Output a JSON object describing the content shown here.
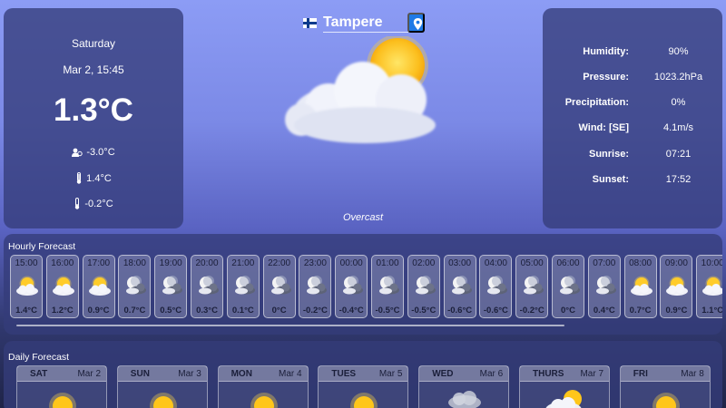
{
  "current": {
    "day": "Saturday",
    "datetime": "Mar 2, 15:45",
    "temperature": "1.3°C",
    "feels_like": "-3.0°C",
    "high": "1.4°C",
    "low": "-0.2°C",
    "condition": "Overcast",
    "icon": "sun-behind-cloud-icon"
  },
  "location": {
    "country_flag": "finland-flag-icon",
    "city": "Tampere",
    "pin_icon": "map-pin-icon",
    "pin_color": "#1f7ae6"
  },
  "details": [
    {
      "label": "Humidity:",
      "value": "90%"
    },
    {
      "label": "Pressure:",
      "value": "1023.2hPa"
    },
    {
      "label": "Precipitation:",
      "value": "0%"
    },
    {
      "label": "Wind: [SE]",
      "value": "4.1m/s"
    },
    {
      "label": "Sunrise:",
      "value": "07:21"
    },
    {
      "label": "Sunset:",
      "value": "17:52"
    }
  ],
  "hourly": {
    "title": "Hourly Forecast",
    "items": [
      {
        "time": "15:00",
        "temp": "1.4°C",
        "icon": "sun-cloud-icon"
      },
      {
        "time": "16:00",
        "temp": "1.2°C",
        "icon": "sun-cloud-icon"
      },
      {
        "time": "17:00",
        "temp": "0.9°C",
        "icon": "sun-cloud-icon"
      },
      {
        "time": "18:00",
        "temp": "0.7°C",
        "icon": "moon-cloud-icon"
      },
      {
        "time": "19:00",
        "temp": "0.5°C",
        "icon": "moon-cloud-icon"
      },
      {
        "time": "20:00",
        "temp": "0.3°C",
        "icon": "moon-cloud-icon"
      },
      {
        "time": "21:00",
        "temp": "0.1°C",
        "icon": "moon-cloud-icon"
      },
      {
        "time": "22:00",
        "temp": "0°C",
        "icon": "moon-cloud-icon"
      },
      {
        "time": "23:00",
        "temp": "-0.2°C",
        "icon": "moon-cloud-icon"
      },
      {
        "time": "00:00",
        "temp": "-0.4°C",
        "icon": "moon-cloud-icon"
      },
      {
        "time": "01:00",
        "temp": "-0.5°C",
        "icon": "moon-cloud-icon"
      },
      {
        "time": "02:00",
        "temp": "-0.5°C",
        "icon": "moon-cloud-icon"
      },
      {
        "time": "03:00",
        "temp": "-0.6°C",
        "icon": "moon-cloud-icon"
      },
      {
        "time": "04:00",
        "temp": "-0.6°C",
        "icon": "moon-cloud-icon"
      },
      {
        "time": "05:00",
        "temp": "-0.2°C",
        "icon": "moon-cloud-icon"
      },
      {
        "time": "06:00",
        "temp": "0°C",
        "icon": "moon-cloud-icon"
      },
      {
        "time": "07:00",
        "temp": "0.4°C",
        "icon": "moon-cloud-icon"
      },
      {
        "time": "08:00",
        "temp": "0.7°C",
        "icon": "sun-cloud-icon"
      },
      {
        "time": "09:00",
        "temp": "0.9°C",
        "icon": "sun-cloud-icon"
      },
      {
        "time": "10:00",
        "temp": "1.1°C",
        "icon": "sun-cloud-icon"
      }
    ]
  },
  "daily": {
    "title": "Daily Forecast",
    "items": [
      {
        "day": "SAT",
        "date": "Mar 2",
        "icon": "sun-icon"
      },
      {
        "day": "SUN",
        "date": "Mar 3",
        "icon": "sun-icon"
      },
      {
        "day": "MON",
        "date": "Mar 4",
        "icon": "sun-icon"
      },
      {
        "day": "TUES",
        "date": "Mar 5",
        "icon": "sun-icon"
      },
      {
        "day": "WED",
        "date": "Mar 6",
        "icon": "fog-icon"
      },
      {
        "day": "THURS",
        "date": "Mar 7",
        "icon": "sun-behind-cloud-icon"
      },
      {
        "day": "FRI",
        "date": "Mar 8",
        "icon": "sun-icon"
      }
    ]
  }
}
